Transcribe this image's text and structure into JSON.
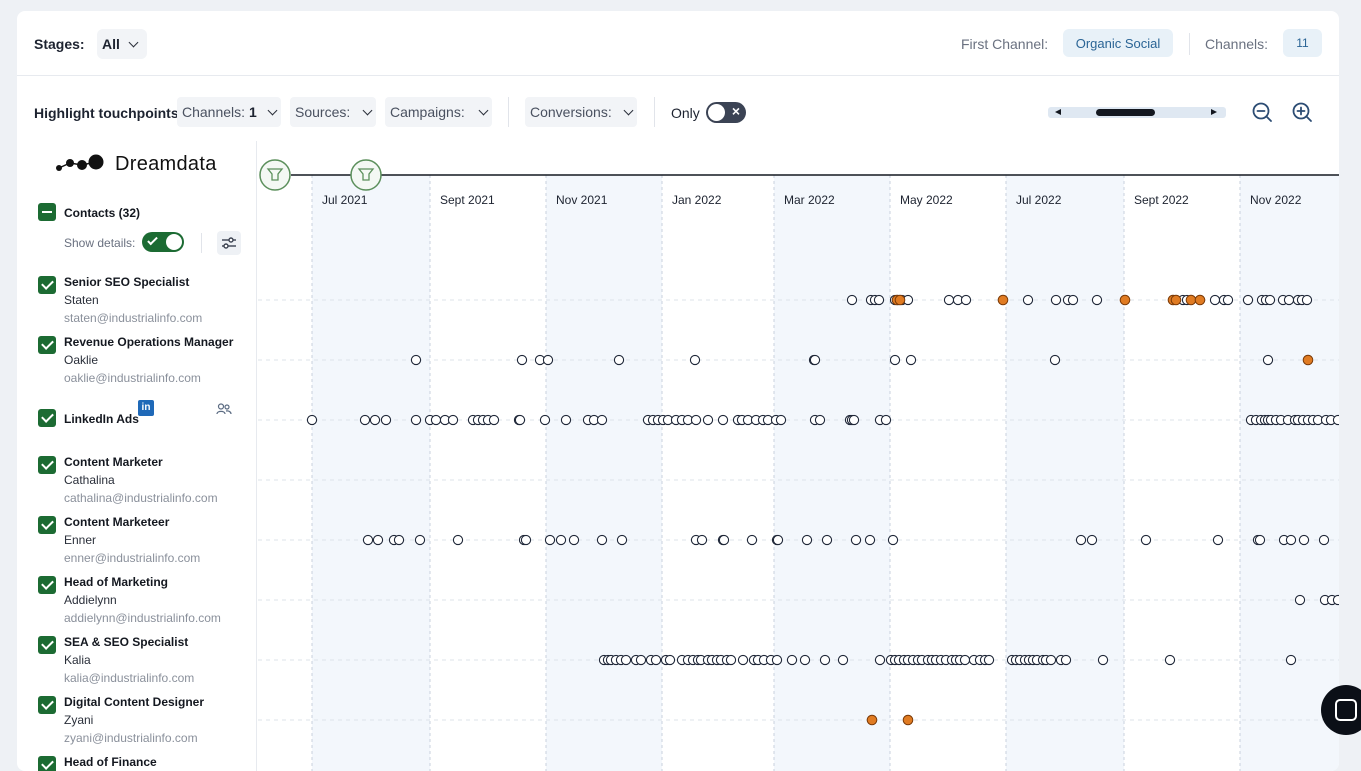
{
  "header": {
    "stages_label": "Stages:",
    "stages_value": "All",
    "first_channel_label": "First Channel:",
    "first_channel_value": "Organic Social",
    "channels_label": "Channels:",
    "channels_value": "11"
  },
  "highlight": {
    "title": "Highlight touchpoints",
    "filters": [
      {
        "label": "Channels:",
        "value": "1"
      },
      {
        "label": "Sources:",
        "value": ""
      },
      {
        "label": "Campaigns:",
        "value": ""
      },
      {
        "label": "Conversions:",
        "value": ""
      }
    ],
    "only_label": "Only"
  },
  "sidebar": {
    "logo": "Dreamdata",
    "contacts_label": "Contacts (32)",
    "show_details_label": "Show details:",
    "rows": [
      {
        "title": "Senior SEO Specialist",
        "name": "Staten",
        "email": "staten@industrialinfo.com"
      },
      {
        "title": "Revenue Operations Manager",
        "name": "Oaklie",
        "email": "oaklie@industrialinfo.com"
      },
      {
        "title": "LinkedIn Ads",
        "name": "",
        "email": ""
      },
      {
        "title": "Content Marketer",
        "name": "Cathalina",
        "email": "cathalina@industrialinfo.com"
      },
      {
        "title": "Content Marketeer",
        "name": "Enner",
        "email": "enner@industrialinfo.com"
      },
      {
        "title": "Head of Marketing",
        "name": "Addielynn",
        "email": "addielynn@industrialinfo.com"
      },
      {
        "title": "SEA & SEO Specialist",
        "name": "Kalia",
        "email": "kalia@industrialinfo.com"
      },
      {
        "title": "Digital Content Designer",
        "name": "Zyani",
        "email": "zyani@industrialinfo.com"
      },
      {
        "title": "Head of Finance",
        "name": "",
        "email": ""
      }
    ]
  },
  "timeline": {
    "months": [
      "Jul 2021",
      "Sept 2021",
      "Nov 2021",
      "Jan 2022",
      "Mar 2022",
      "May 2022",
      "Jul 2022",
      "Sept 2022",
      "Nov 2022"
    ],
    "colors": {
      "highlight": "#e07b22",
      "normal_fill": "#ffffff",
      "shade": "#f3f7fc",
      "marker_green": "#5b8f5b"
    },
    "rows": [
      {
        "normal": [
          594,
          613,
          617,
          621,
          637,
          640,
          644,
          650,
          691,
          700,
          708,
          770,
          798,
          810,
          815,
          839,
          925,
          929,
          957,
          966,
          970,
          990,
          1004,
          1008,
          1012,
          1025,
          1031,
          1040,
          1044,
          1049
        ],
        "highlight": [
          639,
          642,
          745,
          867,
          915,
          918,
          933,
          942
        ]
      },
      {
        "normal": [
          158,
          264,
          282,
          290,
          361,
          437,
          556,
          557,
          637,
          653,
          797,
          1010
        ],
        "highlight": [
          1050
        ]
      },
      {
        "normal": [
          54,
          107,
          117,
          128,
          158,
          172,
          178,
          187,
          195,
          215,
          220,
          225,
          230,
          236,
          261,
          262,
          287,
          308,
          330,
          336,
          344,
          390,
          395,
          400,
          405,
          410,
          418,
          424,
          430,
          438,
          450,
          465,
          480,
          484,
          490,
          498,
          505,
          510,
          518,
          523,
          557,
          562,
          592,
          594,
          596,
          622,
          628,
          993,
          998,
          1003,
          1007,
          1010,
          1013,
          1018,
          1023,
          1030,
          1037,
          1040,
          1045,
          1050,
          1055,
          1060,
          1068,
          1073,
          1080
        ],
        "highlight": []
      },
      {
        "normal": [],
        "highlight": []
      },
      {
        "normal": [
          110,
          120,
          136,
          141,
          162,
          200,
          266,
          268,
          292,
          303,
          316,
          344,
          364,
          438,
          444,
          465,
          466,
          494,
          519,
          520,
          549,
          569,
          598,
          612,
          635,
          823,
          834,
          888,
          960,
          1000,
          1002,
          1026,
          1033,
          1046,
          1066
        ],
        "highlight": []
      },
      {
        "normal": [
          1042,
          1067,
          1074,
          1080
        ],
        "highlight": []
      },
      {
        "normal": [
          346,
          350,
          353,
          358,
          363,
          368,
          378,
          383,
          393,
          398,
          408,
          412,
          424,
          430,
          435,
          440,
          443,
          450,
          454,
          459,
          463,
          469,
          473,
          485,
          496,
          500,
          506,
          513,
          519,
          534,
          547,
          567,
          585,
          622,
          633,
          637,
          641,
          646,
          650,
          655,
          660,
          664,
          670,
          674,
          678,
          683,
          688,
          694,
          698,
          702,
          707,
          716,
          722,
          727,
          731,
          754,
          758,
          762,
          767,
          771,
          775,
          779,
          785,
          788,
          793,
          803,
          808,
          845,
          912,
          1033
        ],
        "highlight": []
      },
      {
        "normal": [],
        "highlight": [
          614,
          650
        ]
      }
    ]
  }
}
